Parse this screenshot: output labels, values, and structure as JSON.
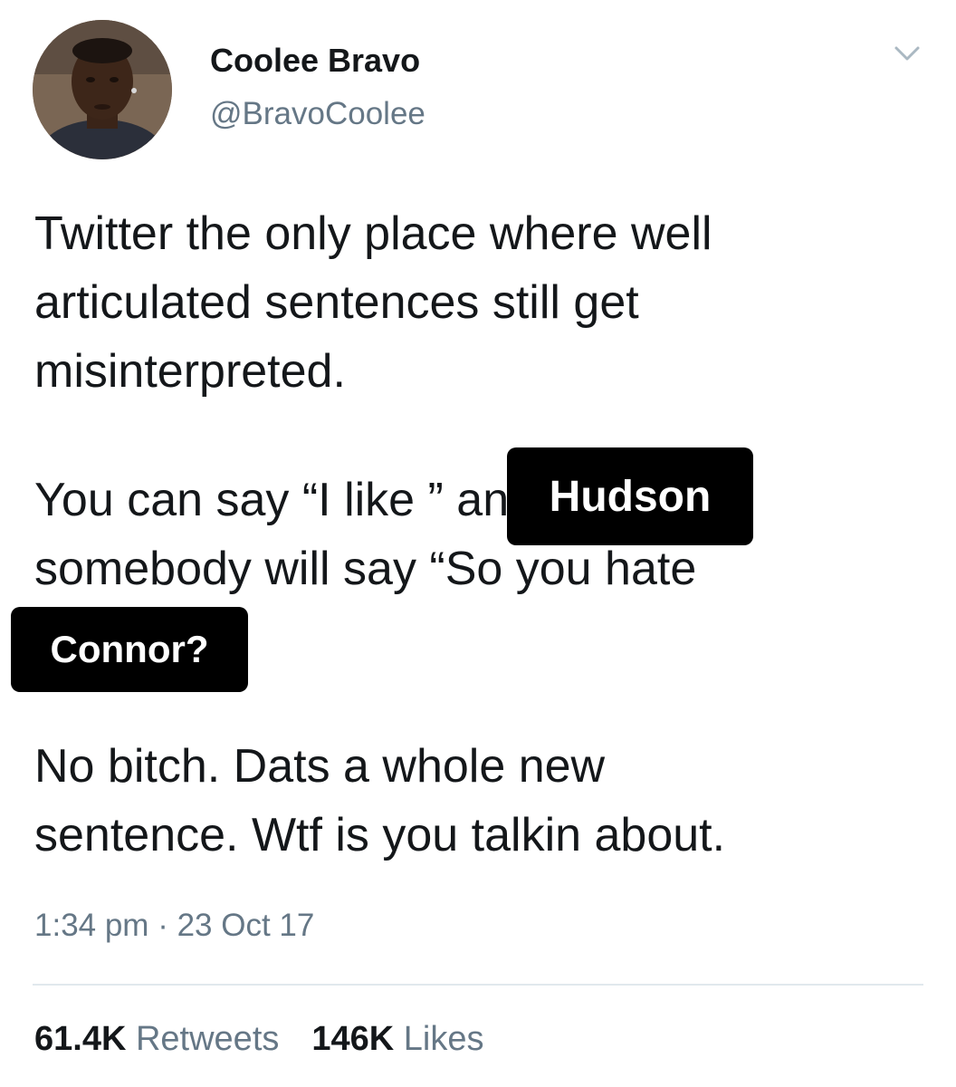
{
  "author": {
    "display_name": "Coolee Bravo",
    "handle": "@BravoCoolee",
    "avatar_icon": "user-avatar-photo"
  },
  "menu_icon": "chevron-down-icon",
  "tweet": {
    "paragraph1": {
      "line1": "Twitter the only place where well",
      "line2": "articulated sentences still get",
      "line3": "misinterpreted."
    },
    "paragraph2": {
      "line1": "You can say “I like                            ” and",
      "line2": "somebody will say “So you hate",
      "line3": "                            ”"
    },
    "paragraph3": {
      "line1": "No bitch. Dats a whole new",
      "line2": "sentence. Wtf is you talkin about."
    },
    "overlay_label_1": "Hudson",
    "overlay_label_2": "Connor?"
  },
  "timestamp": "1:34 pm · 23 Oct 17",
  "stats": {
    "retweets_count": "61.4K",
    "retweets_label": "Retweets",
    "likes_count": "146K",
    "likes_label": "Likes"
  },
  "colors": {
    "primary_text": "#14171a",
    "secondary_text": "#657786",
    "divider": "#e1e8ed",
    "overlay_bg": "#000000"
  }
}
